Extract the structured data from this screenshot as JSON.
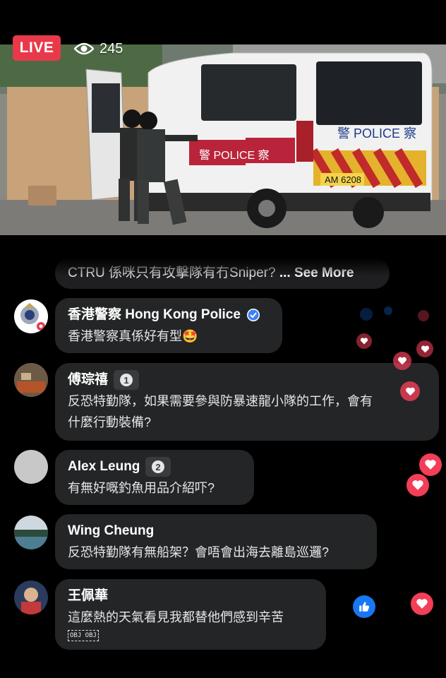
{
  "live": {
    "label": "LIVE",
    "viewer_count": "245"
  },
  "video": {
    "van_plate": "AM 6208",
    "van_text_side": "警 POLICE 察",
    "van_text_rear": "警 POLICE 察"
  },
  "truncated_comment": {
    "text": "CTRU 係咪只有攻擊隊有冇Sniper? ",
    "see_more": "... See More"
  },
  "comments": [
    {
      "name": "香港警察 Hong Kong Police",
      "text": "香港警察真係好有型🤩"
    },
    {
      "name": "傅琮禧",
      "badge": "1",
      "text_line1": "反恐特勤隊，如果需要參與防暴速龍小隊的工作，會有",
      "text_line2": "什麼行動裝備?"
    },
    {
      "name": "Alex Leung",
      "badge": "2",
      "text": "有無好嘅釣魚用品介紹吓?"
    },
    {
      "name": "Wing Cheung",
      "text": "反恐特勤隊有無船架？會唔會出海去離島巡邏?"
    },
    {
      "name": "王佩華",
      "text": "這麼熱的天氣看見我都替他們感到辛苦",
      "emoji_placeholder": "OBJ OBJ"
    }
  ],
  "colors": {
    "live_red": "#e8394b",
    "bubble_bg": "#242526",
    "heart_red": "#f33e58",
    "like_blue": "#1877f2"
  }
}
